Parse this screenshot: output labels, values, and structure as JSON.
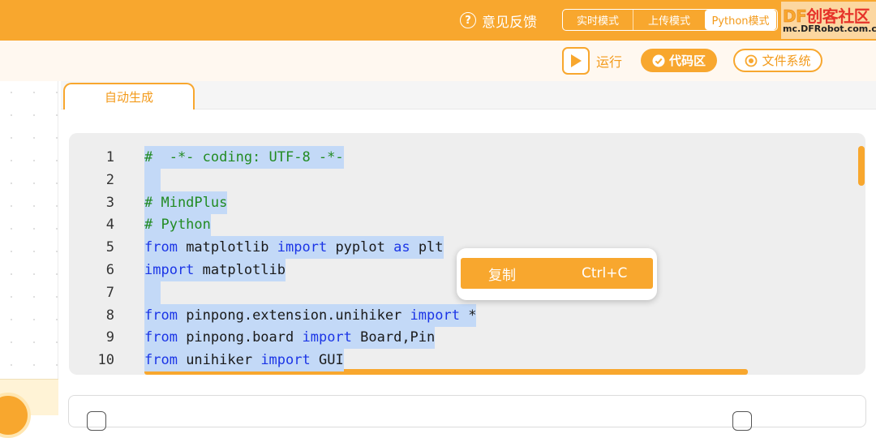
{
  "topbar": {
    "feedback_label": "意见反馈",
    "feedback_icon": "question-circle-icon",
    "modes": [
      {
        "label": "实时模式",
        "active": false
      },
      {
        "label": "上传模式",
        "active": false
      },
      {
        "label": "Python模式",
        "active": true
      }
    ],
    "brand_df": "DF",
    "brand_cn": "创客社区",
    "brand_url": "mc.DFRobot.com.cn"
  },
  "toolbar": {
    "run_label": "运行",
    "code_area_label": "代码区",
    "file_system_label": "文件系统"
  },
  "editor": {
    "tab_label": "自动生成",
    "lines": [
      {
        "n": "1",
        "tokens": [
          {
            "t": "#  -*- coding: UTF-8 -*-",
            "c": "cm"
          }
        ]
      },
      {
        "n": "2",
        "tokens": [
          {
            "t": "  ",
            "c": "tx"
          }
        ]
      },
      {
        "n": "3",
        "tokens": [
          {
            "t": "# MindPlus",
            "c": "cm"
          }
        ]
      },
      {
        "n": "4",
        "tokens": [
          {
            "t": "# Python",
            "c": "cm"
          }
        ]
      },
      {
        "n": "5",
        "tokens": [
          {
            "t": "from",
            "c": "kw"
          },
          {
            "t": " matplotlib ",
            "c": "tx"
          },
          {
            "t": "import",
            "c": "kw"
          },
          {
            "t": " pyplot ",
            "c": "tx"
          },
          {
            "t": "as",
            "c": "kw"
          },
          {
            "t": " plt",
            "c": "tx"
          }
        ]
      },
      {
        "n": "6",
        "tokens": [
          {
            "t": "import",
            "c": "kw"
          },
          {
            "t": " matplotlib",
            "c": "tx"
          }
        ]
      },
      {
        "n": "7",
        "tokens": [
          {
            "t": "  ",
            "c": "tx"
          }
        ]
      },
      {
        "n": "8",
        "tokens": [
          {
            "t": "from",
            "c": "kw"
          },
          {
            "t": " pinpong.extension.unihiker ",
            "c": "tx"
          },
          {
            "t": "import",
            "c": "kw"
          },
          {
            "t": " *",
            "c": "tx"
          }
        ]
      },
      {
        "n": "9",
        "tokens": [
          {
            "t": "from",
            "c": "kw"
          },
          {
            "t": " pinpong.board ",
            "c": "tx"
          },
          {
            "t": "import",
            "c": "kw"
          },
          {
            "t": " Board,Pin",
            "c": "tx"
          }
        ]
      },
      {
        "n": "10",
        "tokens": [
          {
            "t": "from",
            "c": "kw"
          },
          {
            "t": " unihiker ",
            "c": "tx"
          },
          {
            "t": "import",
            "c": "kw"
          },
          {
            "t": " GUI",
            "c": "tx"
          }
        ]
      }
    ]
  },
  "context_menu": {
    "items": [
      {
        "label": "复制",
        "shortcut": "Ctrl+C"
      }
    ]
  },
  "colors": {
    "accent": "#f8a72e",
    "selection": "#c3d9f7",
    "keyword": "#1b35e6",
    "comment": "#228b22"
  }
}
